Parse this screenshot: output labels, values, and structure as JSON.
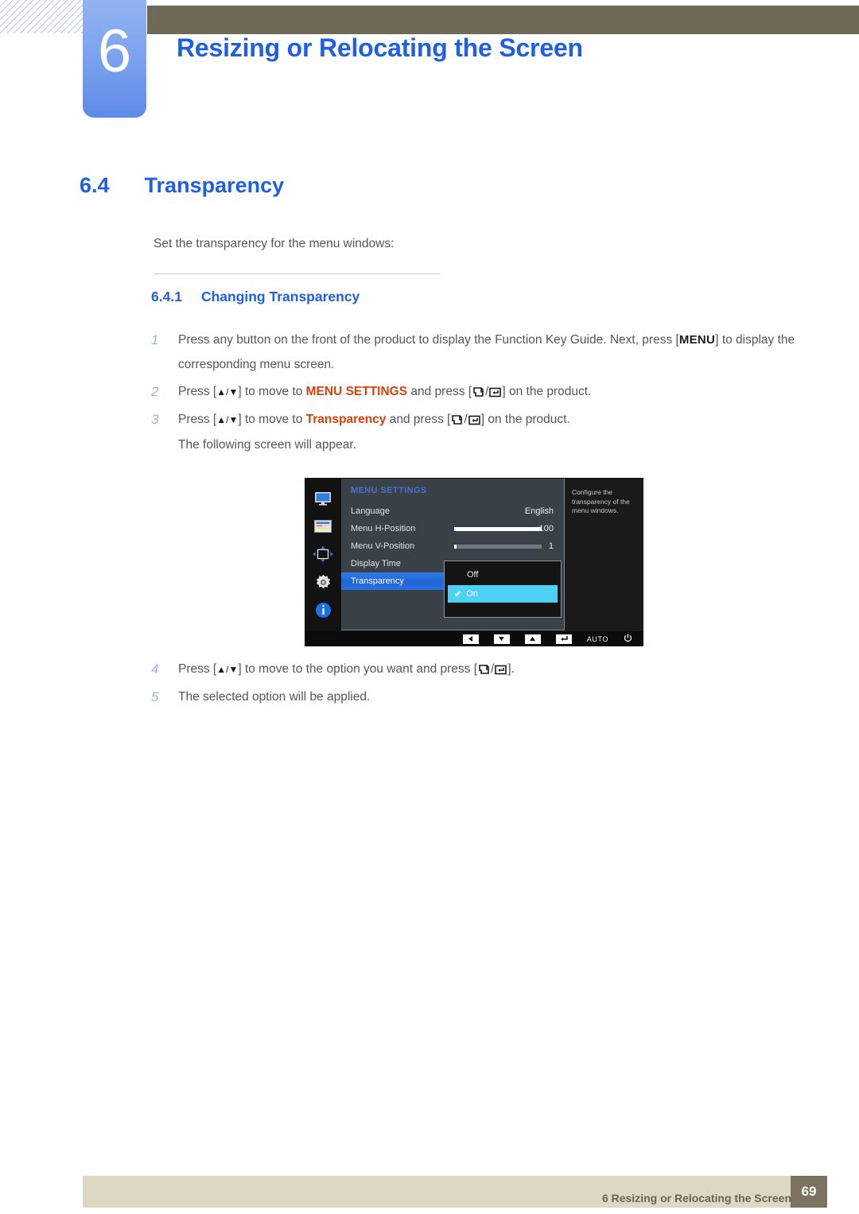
{
  "header": {
    "chapter_number": "6",
    "chapter_title": "Resizing or Relocating the Screen"
  },
  "section": {
    "number": "6.4",
    "title": "Transparency",
    "intro": "Set the transparency for the menu windows:",
    "subsection_number": "6.4.1",
    "subsection_title": "Changing Transparency"
  },
  "steps": [
    {
      "index": "1",
      "prefix": "Press any button on the front of the product to display the Function Key Guide. Next, press [",
      "kbd": "MENU",
      "suffix": "] to display the corresponding menu screen."
    },
    {
      "index": "2",
      "pre": "Press [",
      "arrows": "▲/▼",
      "mid": "] to move to ",
      "highlight": "MENU SETTINGS",
      "mid2": " and press [",
      "post": "] on the product."
    },
    {
      "index": "3",
      "pre": "Press [",
      "arrows": "▲/▼",
      "mid": "] to move to ",
      "highlight": "Transparency",
      "mid2": " and press [",
      "post": "] on the product.",
      "note": "The following screen will appear."
    },
    {
      "index": "4",
      "pre": "Press [",
      "arrows": "▲/▼",
      "mid": "] to move to the option you want and press [",
      "post": "]."
    },
    {
      "index": "5",
      "text": "The selected option will be applied."
    }
  ],
  "osd": {
    "heading": "MENU SETTINGS",
    "rail_icons": [
      "display-icon",
      "picture-settings-icon",
      "position-arrows-icon",
      "gear-icon",
      "info-icon"
    ],
    "rows": [
      {
        "label": "Language",
        "value": "English",
        "type": "value"
      },
      {
        "label": "Menu H-Position",
        "value": "100",
        "type": "slider",
        "fill": 100
      },
      {
        "label": "Menu V-Position",
        "value": "1",
        "type": "slider",
        "fill": 3
      },
      {
        "label": "Display Time",
        "value": "",
        "type": "plain"
      },
      {
        "label": "Transparency",
        "value": "",
        "type": "selected"
      }
    ],
    "help_text": "Configure the transparency of the menu windows.",
    "dropdown": {
      "options": [
        {
          "label": "Off",
          "checked": false
        },
        {
          "label": "On",
          "checked": true
        }
      ],
      "check_glyph": "✔"
    },
    "bottom_buttons": [
      {
        "name": "left-arrow-button",
        "glyph": "◀"
      },
      {
        "name": "down-arrow-button",
        "glyph": "▼"
      },
      {
        "name": "up-arrow-button",
        "glyph": "▲"
      },
      {
        "name": "enter-button",
        "glyph": "↵"
      },
      {
        "name": "auto-button",
        "label": "AUTO"
      },
      {
        "name": "power-button",
        "glyph": "⏻"
      }
    ]
  },
  "footer": {
    "text": "6 Resizing or Relocating the Screen",
    "page_number": "69"
  },
  "colors": {
    "accent_blue": "#1f5fe0",
    "highlight_orange": "#d9400b",
    "header_olive": "#6e6a55",
    "footer_beige": "#dcd8c4",
    "badge_brown": "#7b7261",
    "osd_cyan": "#4fd1f5"
  }
}
